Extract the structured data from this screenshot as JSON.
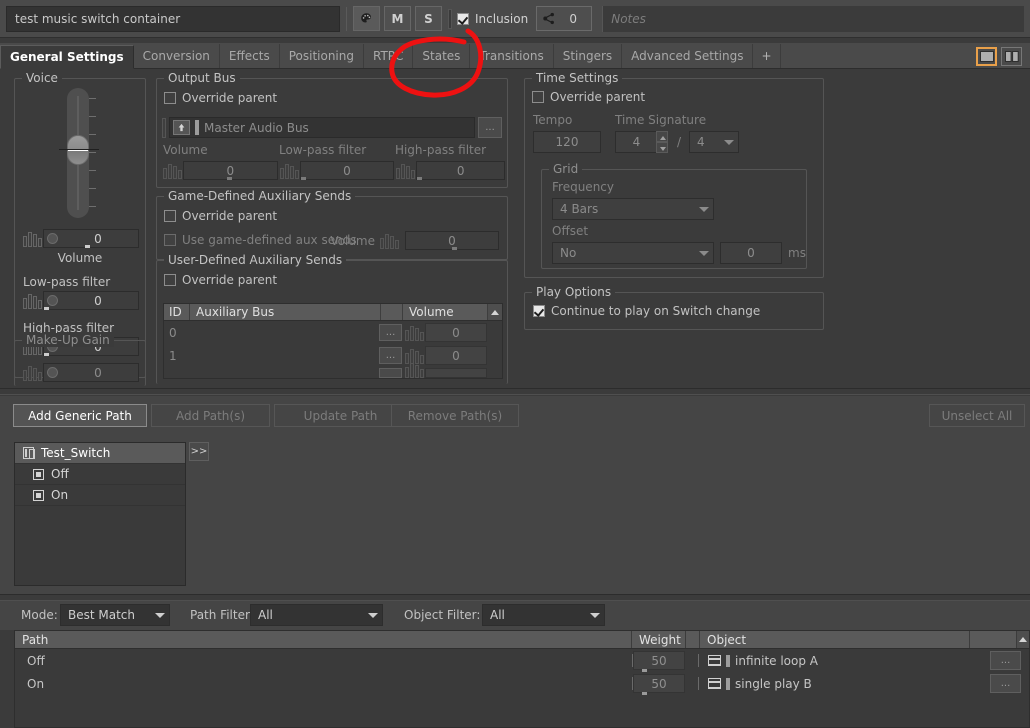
{
  "header": {
    "object_name": "test music switch container",
    "palette_icon": "palette-icon",
    "mute_label": "M",
    "solo_label": "S",
    "inclusion_label": "Inclusion",
    "inclusion_checked": true,
    "share_icon": "share-icon",
    "share_count": "0",
    "notes_placeholder": "Notes"
  },
  "tabs": {
    "items": [
      {
        "label": "General Settings",
        "active": true
      },
      {
        "label": "Conversion",
        "active": false
      },
      {
        "label": "Effects",
        "active": false
      },
      {
        "label": "Positioning",
        "active": false
      },
      {
        "label": "RTPC",
        "active": false
      },
      {
        "label": "States",
        "active": false
      },
      {
        "label": "Transitions",
        "active": false
      },
      {
        "label": "Stingers",
        "active": false
      },
      {
        "label": "Advanced Settings",
        "active": false
      },
      {
        "label": "+",
        "active": false
      }
    ],
    "layout_single": "single-pane-icon",
    "layout_split": "split-pane-icon"
  },
  "voice": {
    "legend": "Voice",
    "volume_value": "0",
    "volume_label": "Volume",
    "lowpass_label": "Low-pass filter",
    "lowpass_value": "0",
    "highpass_label": "High-pass filter",
    "highpass_value": "0",
    "makeup_legend": "Make-Up Gain",
    "makeup_value": "0"
  },
  "output_bus": {
    "legend": "Output Bus",
    "override_label": "Override parent",
    "override_checked": false,
    "bus_name": "Master Audio Bus",
    "browse_label": "...",
    "volume_label": "Volume",
    "volume_value": "0",
    "lowpass_label": "Low-pass filter",
    "lowpass_value": "0",
    "highpass_label": "High-pass filter",
    "highpass_value": "0"
  },
  "game_aux": {
    "legend": "Game-Defined Auxiliary Sends",
    "override_label": "Override parent",
    "override_checked": false,
    "use_label": "Use game-defined aux sends",
    "use_checked": false,
    "volume_label": "Volume",
    "volume_value": "0"
  },
  "user_aux": {
    "legend": "User-Defined Auxiliary Sends",
    "override_label": "Override parent",
    "override_checked": false,
    "columns": [
      "ID",
      "Auxiliary Bus",
      "",
      "Volume"
    ],
    "rows": [
      {
        "id": "0",
        "bus": "",
        "browse": "...",
        "volume": "0"
      },
      {
        "id": "1",
        "bus": "",
        "browse": "...",
        "volume": "0"
      }
    ]
  },
  "time_settings": {
    "legend": "Time Settings",
    "override_label": "Override parent",
    "override_checked": false,
    "tempo_label": "Tempo",
    "tempo_value": "120",
    "time_signature_label": "Time Signature",
    "signature_numerator": "4",
    "signature_separator": "/",
    "signature_denominator": "4",
    "grid_legend": "Grid",
    "frequency_label": "Frequency",
    "frequency_value": "4 Bars",
    "offset_label": "Offset",
    "offset_value": "No",
    "offset_ms_value": "0",
    "offset_units": "ms"
  },
  "play_options": {
    "legend": "Play Options",
    "continue_label": "Continue to play on Switch change",
    "continue_checked": true
  },
  "path_toolbar": {
    "add_generic_path": "Add Generic Path",
    "add_paths": "Add Path(s)",
    "update_path": "Update Path",
    "remove_paths": "Remove Path(s)",
    "unselect_all": "Unselect All"
  },
  "switch_tree": {
    "expand_label": ">>",
    "items": [
      {
        "label": "Test_Switch",
        "icon": "switch-group-icon",
        "selected": true,
        "child": false
      },
      {
        "label": "Off",
        "icon": "switch-state-icon",
        "selected": false,
        "child": true
      },
      {
        "label": "On",
        "icon": "switch-state-icon",
        "selected": false,
        "child": true
      }
    ]
  },
  "filters": {
    "mode_label": "Mode:",
    "mode_value": "Best Match",
    "path_filter_label": "Path Filter:",
    "path_filter_value": "All",
    "object_filter_label": "Object Filter:",
    "object_filter_value": "All"
  },
  "path_grid": {
    "columns": [
      "Path",
      "Weight",
      "Object",
      ""
    ],
    "rows": [
      {
        "path": "Off",
        "weight": "50",
        "object": "infinite loop A",
        "object_icon": "music-segment-icon",
        "browse": "..."
      },
      {
        "path": "On",
        "weight": "50",
        "object": "single play B",
        "object_icon": "music-segment-icon",
        "browse": "..."
      }
    ]
  },
  "annotation": {
    "shape": "red-circle-around-transitions-tab",
    "color": "#ee1111"
  }
}
